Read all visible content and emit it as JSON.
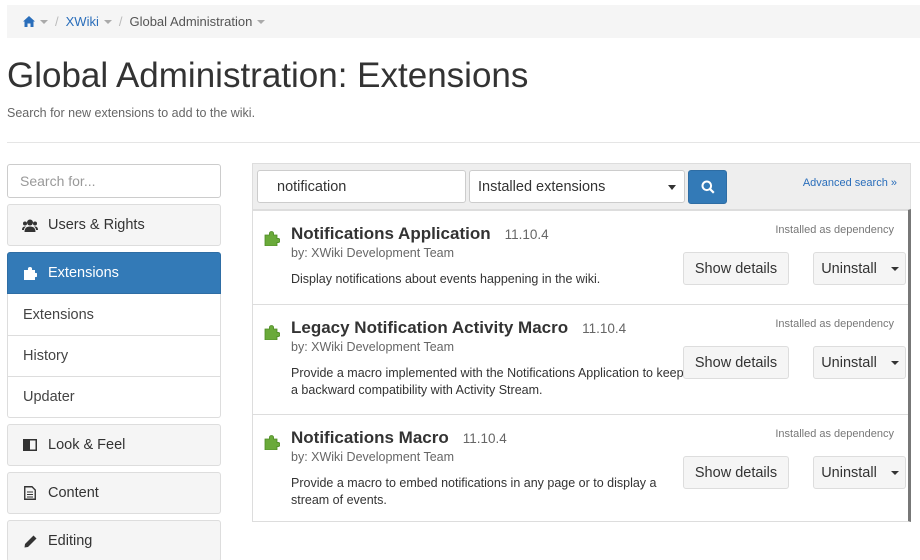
{
  "breadcrumb": {
    "home_icon": "home-icon",
    "items": [
      "XWiki",
      "Global Administration"
    ],
    "separator": "/"
  },
  "header": {
    "title": "Global Administration: Extensions",
    "subtitle": "Search for new extensions to add to the wiki."
  },
  "sidebar": {
    "search_placeholder": "Search for...",
    "sections": [
      {
        "label": "Users & Rights",
        "icon": "users-icon"
      },
      {
        "label": "Extensions",
        "icon": "puzzle-icon",
        "active": true
      },
      {
        "label": "Look & Feel",
        "icon": "columns-icon"
      },
      {
        "label": "Content",
        "icon": "document-icon"
      },
      {
        "label": "Editing",
        "icon": "pencil-icon"
      }
    ],
    "sub_items": [
      "Extensions",
      "History",
      "Updater"
    ]
  },
  "search": {
    "value": "notification",
    "filter_selected": "Installed extensions",
    "advanced_label": "Advanced search »"
  },
  "extensions": [
    {
      "name": "Notifications Application",
      "version": "11.10.4",
      "author": "by: XWiki Development Team",
      "description": "Display notifications about events happening in the wiki.",
      "status": "Installed as dependency"
    },
    {
      "name": "Legacy Notification Activity Macro",
      "version": "11.10.4",
      "author": "by: XWiki Development Team",
      "description": "Provide a macro implemented with the Notifications Application to keep a backward compatibility with Activity Stream.",
      "status": "Installed as dependency"
    },
    {
      "name": "Notifications Macro",
      "version": "11.10.4",
      "author": "by: XWiki Development Team",
      "description": "Provide a macro to embed notifications in any page or to display a stream of events.",
      "status": "Installed as dependency"
    }
  ],
  "actions": {
    "details_label": "Show details",
    "uninstall_label": "Uninstall"
  },
  "colors": {
    "primary": "#337ab7",
    "link": "#2a6ebb",
    "puzzle_green": "#6aaa3a"
  }
}
